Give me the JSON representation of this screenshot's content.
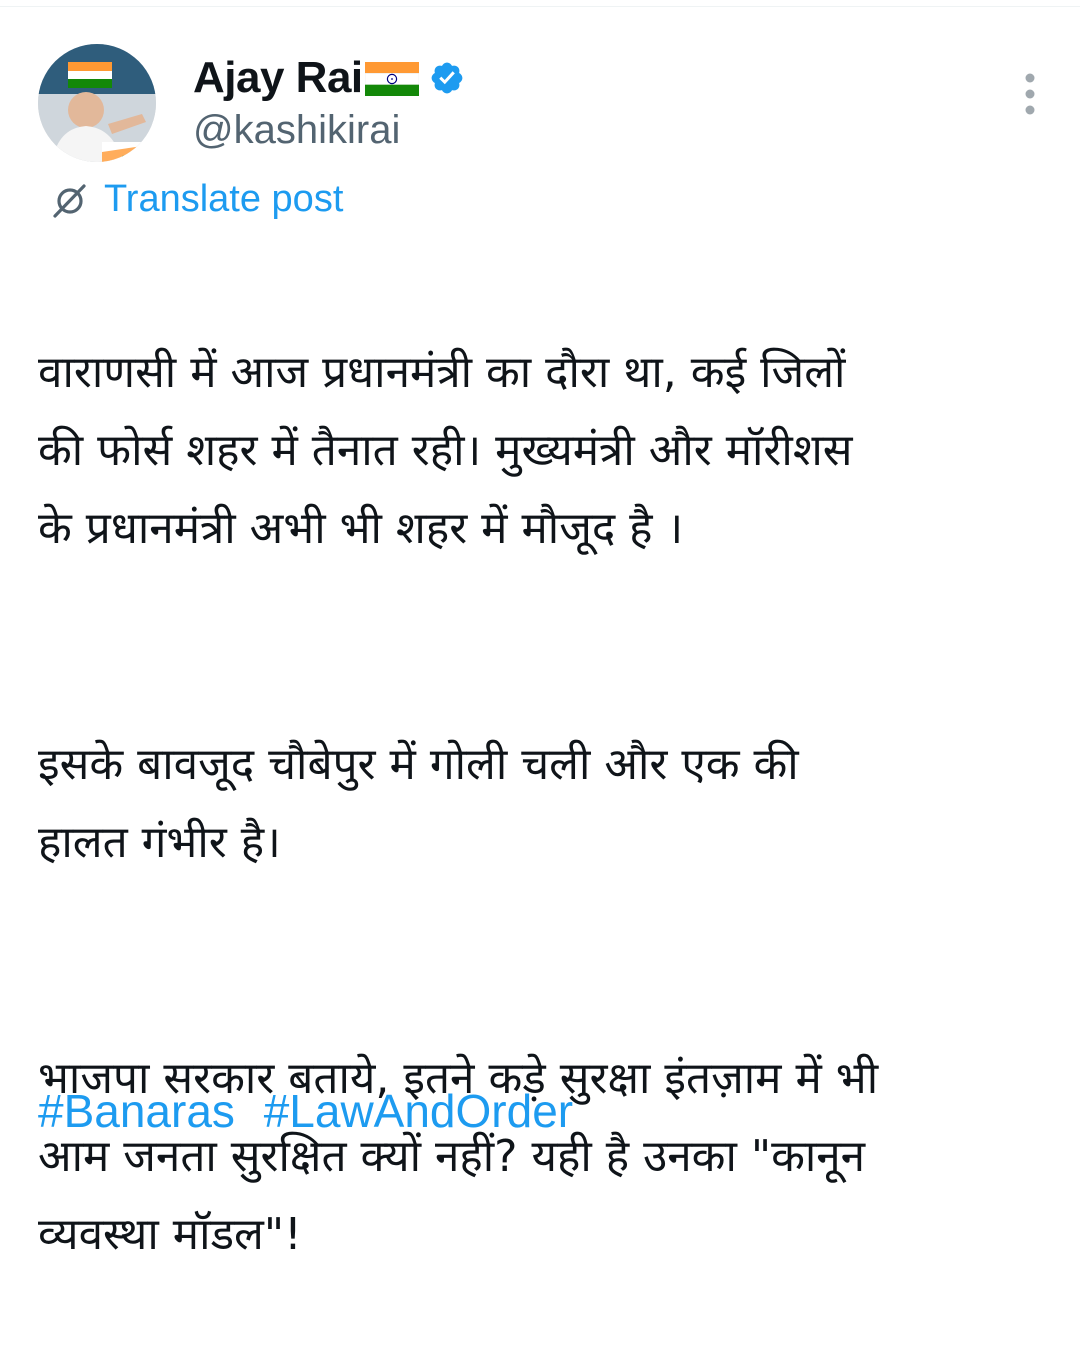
{
  "post": {
    "author": {
      "display_name": "Ajay Rai",
      "handle": "@kashikirai",
      "badge": "verified-badge-icon",
      "name_emoji": "india-flag-icon"
    },
    "translate_label": "Translate post",
    "paragraphs": [
      "वाराणसी में आज प्रधानमंत्री का दौरा था, कई जिलों\nकी फोर्स शहर में तैनात रही। मुख्यमंत्री और मॉरीशस\nके प्रधानमंत्री अभी भी शहर में मौजूद है ।",
      "इसके बावजूद चौबेपुर में गोली चली और एक की\nहालत गंभीर है।",
      "भाजपा सरकार बताये, इतने कड़े सुरक्षा इंतज़ाम में भी\nआम जनता सुरक्षित क्यों नहीं? यही है उनका \"कानून\nव्यवस्था मॉडल\"!"
    ],
    "hashtags": [
      "#Banaras",
      "#LawAndOrder"
    ]
  },
  "colors": {
    "link": "#1d9bf0",
    "secondary_text": "#536471",
    "primary_text": "#0f1419"
  }
}
